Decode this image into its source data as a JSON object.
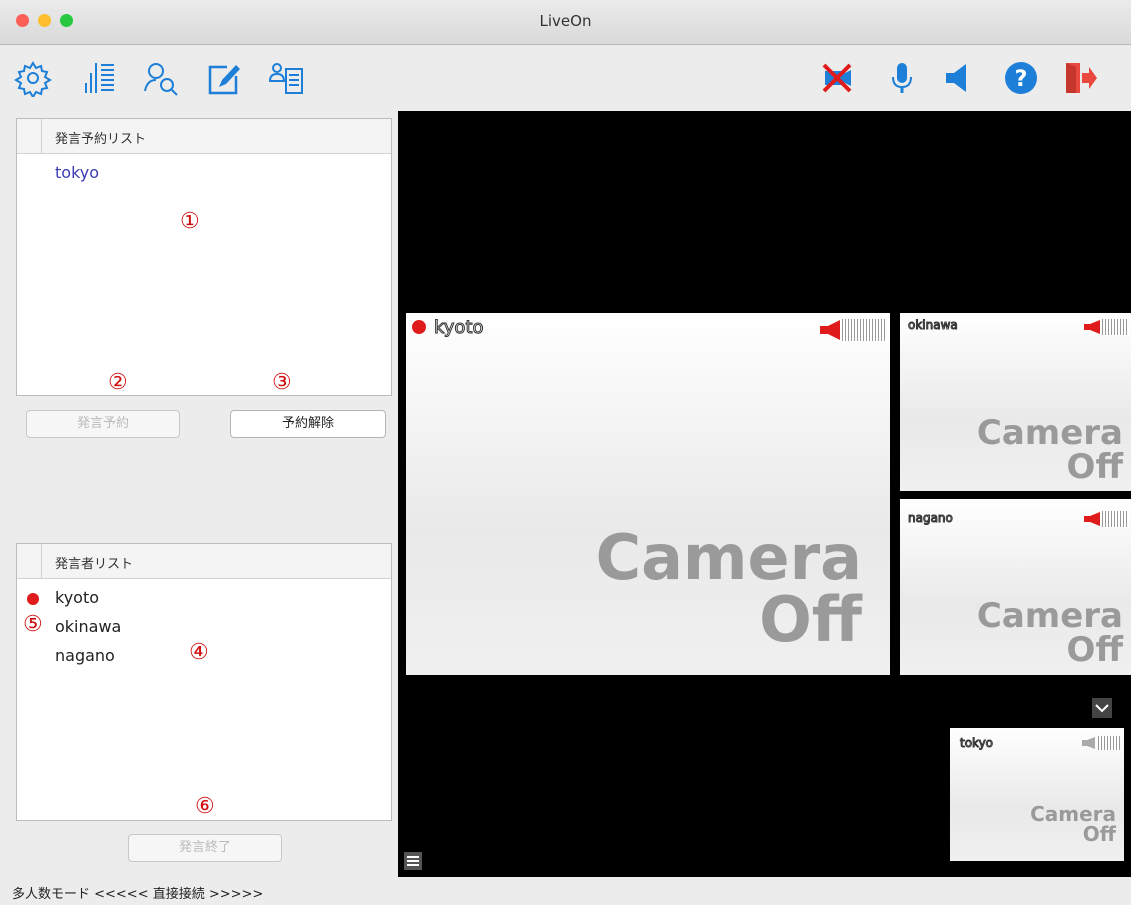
{
  "window": {
    "title": "LiveOn"
  },
  "toolbar": {
    "left_icons": [
      "gear-icon",
      "level-meter-icon",
      "user-search-icon",
      "whiteboard-edit-icon",
      "member-list-icon"
    ],
    "right_icons": [
      "camera-off-icon",
      "microphone-icon",
      "speaker-icon",
      "help-icon",
      "exit-icon"
    ]
  },
  "reservation_list": {
    "header": "発言予約リスト",
    "items": [
      "tokyo"
    ],
    "reserve_button": "発言予約",
    "cancel_button": "予約解除"
  },
  "speaker_list": {
    "header": "発言者リスト",
    "items": [
      "kyoto",
      "okinawa",
      "nagano"
    ],
    "end_button": "発言終了"
  },
  "annotations": {
    "a1": "①",
    "a2": "②",
    "a3": "③",
    "a4": "④",
    "a5": "⑤",
    "a6": "⑥"
  },
  "video": {
    "main": {
      "name": "kyoto",
      "status_line1": "Camera",
      "status_line2": "Off"
    },
    "tile_okinawa": {
      "name": "okinawa",
      "status_line1": "Camera",
      "status_line2": "Off"
    },
    "tile_nagano": {
      "name": "nagano",
      "status_line1": "Camera",
      "status_line2": "Off"
    },
    "self_view": {
      "name": "tokyo",
      "status_line1": "Camera",
      "status_line2": "Off"
    }
  },
  "status_bar": {
    "text": "多人数モード <<<<< 直接接続 >>>>>"
  },
  "colors": {
    "accent_blue": "#1d7fd8",
    "record_red": "#e01b1b",
    "exit_red": "#e8483d"
  }
}
